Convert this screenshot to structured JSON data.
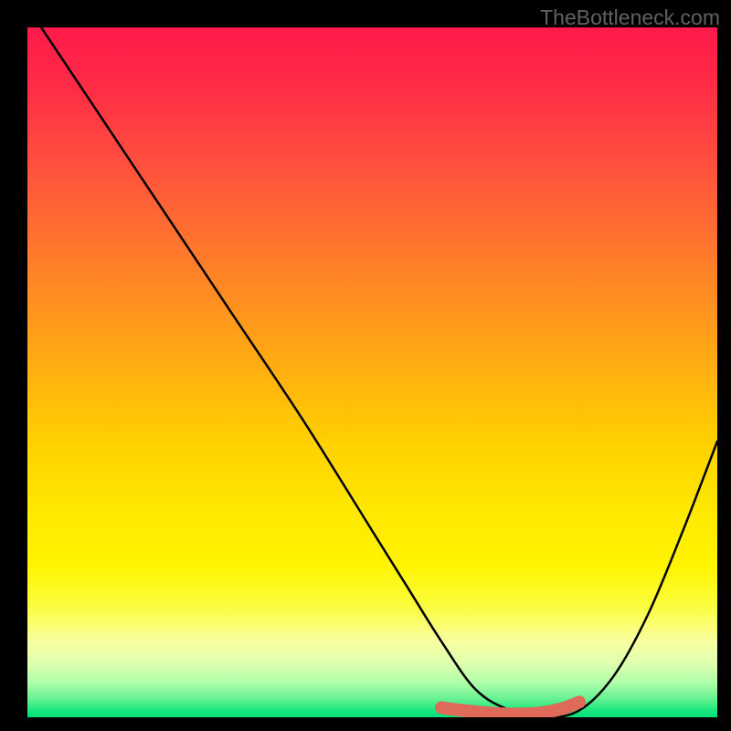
{
  "watermark": "TheBottleneck.com",
  "chart_data": {
    "type": "line",
    "title": "",
    "xlabel": "",
    "ylabel": "",
    "xlim": [
      0,
      100
    ],
    "ylim": [
      0,
      100
    ],
    "grid": false,
    "series": [
      {
        "name": "bottleneck-curve",
        "color": "#000000",
        "x": [
          2,
          10,
          20,
          30,
          40,
          50,
          55,
          60,
          65,
          70,
          75,
          80,
          85,
          90,
          95,
          100
        ],
        "values": [
          100,
          88,
          73,
          58,
          43,
          27,
          19,
          11,
          4,
          1,
          0,
          1,
          6,
          15,
          27,
          40
        ]
      }
    ],
    "highlight_segment": {
      "name": "optimal-range",
      "color": "#e06a5a",
      "x": [
        60,
        63,
        66,
        69,
        72,
        74,
        76,
        78,
        80
      ],
      "values": [
        1.4,
        1.0,
        0.7,
        0.5,
        0.5,
        0.6,
        0.9,
        1.4,
        2.2
      ]
    },
    "background": {
      "type": "vertical-gradient",
      "stops": [
        {
          "pos": 0,
          "color": "#ff1a4a"
        },
        {
          "pos": 50,
          "color": "#ffb010"
        },
        {
          "pos": 78,
          "color": "#fff400"
        },
        {
          "pos": 100,
          "color": "#00e078"
        }
      ]
    }
  }
}
